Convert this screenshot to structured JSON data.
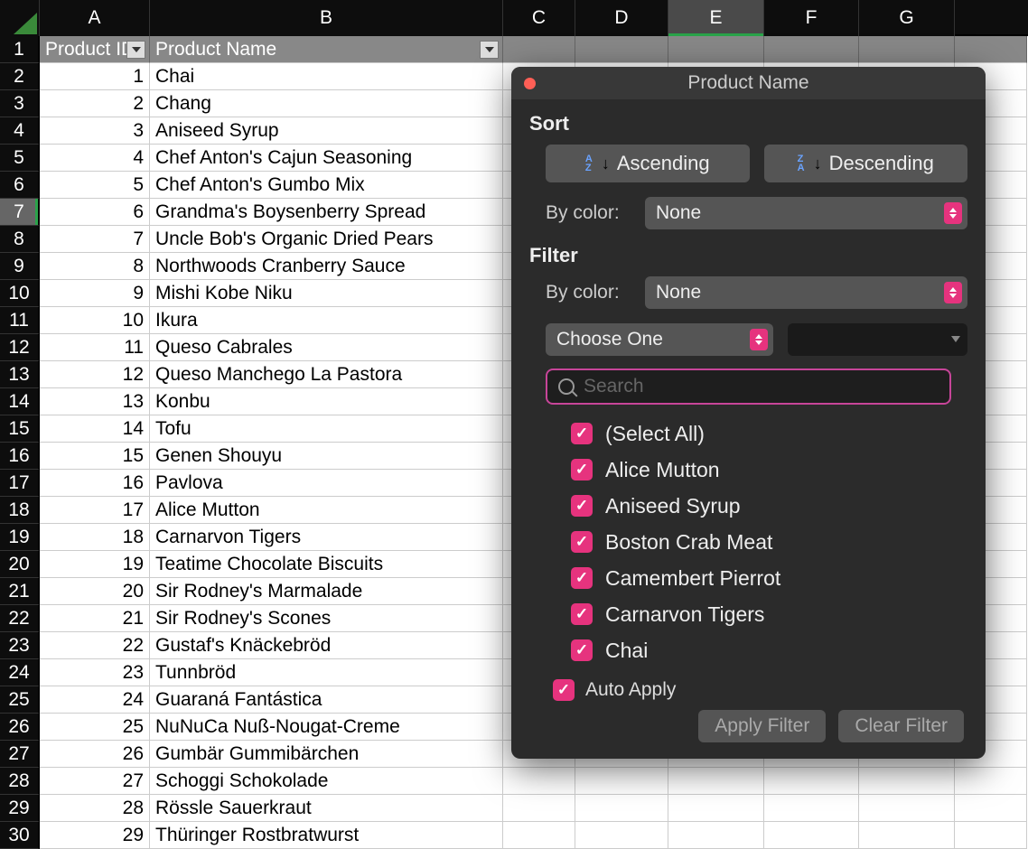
{
  "columns": [
    "A",
    "B",
    "C",
    "D",
    "E",
    "F",
    "G"
  ],
  "active_column": "E",
  "active_row": 7,
  "headers": {
    "a": "Product ID",
    "b": "Product Name"
  },
  "rows": [
    {
      "n": 1,
      "id": "",
      "name": ""
    },
    {
      "n": 2,
      "id": "1",
      "name": "Chai"
    },
    {
      "n": 3,
      "id": "2",
      "name": "Chang"
    },
    {
      "n": 4,
      "id": "3",
      "name": "Aniseed Syrup"
    },
    {
      "n": 5,
      "id": "4",
      "name": "Chef Anton's Cajun Seasoning"
    },
    {
      "n": 6,
      "id": "5",
      "name": "Chef Anton's Gumbo Mix"
    },
    {
      "n": 7,
      "id": "6",
      "name": "Grandma's Boysenberry Spread"
    },
    {
      "n": 8,
      "id": "7",
      "name": "Uncle Bob's Organic Dried Pears"
    },
    {
      "n": 9,
      "id": "8",
      "name": "Northwoods Cranberry Sauce"
    },
    {
      "n": 10,
      "id": "9",
      "name": "Mishi Kobe Niku"
    },
    {
      "n": 11,
      "id": "10",
      "name": "Ikura"
    },
    {
      "n": 12,
      "id": "11",
      "name": "Queso Cabrales"
    },
    {
      "n": 13,
      "id": "12",
      "name": "Queso Manchego La Pastora"
    },
    {
      "n": 14,
      "id": "13",
      "name": "Konbu"
    },
    {
      "n": 15,
      "id": "14",
      "name": "Tofu"
    },
    {
      "n": 16,
      "id": "15",
      "name": "Genen Shouyu"
    },
    {
      "n": 17,
      "id": "16",
      "name": "Pavlova"
    },
    {
      "n": 18,
      "id": "17",
      "name": "Alice Mutton"
    },
    {
      "n": 19,
      "id": "18",
      "name": "Carnarvon Tigers"
    },
    {
      "n": 20,
      "id": "19",
      "name": "Teatime Chocolate Biscuits"
    },
    {
      "n": 21,
      "id": "20",
      "name": "Sir Rodney's Marmalade"
    },
    {
      "n": 22,
      "id": "21",
      "name": "Sir Rodney's Scones"
    },
    {
      "n": 23,
      "id": "22",
      "name": "Gustaf's Knäckebröd"
    },
    {
      "n": 24,
      "id": "23",
      "name": "Tunnbröd"
    },
    {
      "n": 25,
      "id": "24",
      "name": "Guaraná Fantástica"
    },
    {
      "n": 26,
      "id": "25",
      "name": "NuNuCa Nuß-Nougat-Creme"
    },
    {
      "n": 27,
      "id": "26",
      "name": "Gumbär Gummibärchen"
    },
    {
      "n": 28,
      "id": "27",
      "name": "Schoggi Schokolade"
    },
    {
      "n": 29,
      "id": "28",
      "name": "Rössle Sauerkraut"
    },
    {
      "n": 30,
      "id": "29",
      "name": "Thüringer Rostbratwurst"
    }
  ],
  "popup": {
    "title": "Product Name",
    "sort_label": "Sort",
    "ascending": "Ascending",
    "descending": "Descending",
    "by_color": "By color:",
    "none": "None",
    "filter_label": "Filter",
    "choose_one": "Choose One",
    "search_placeholder": "Search",
    "items": [
      "(Select All)",
      "Alice Mutton",
      "Aniseed Syrup",
      "Boston Crab Meat",
      "Camembert Pierrot",
      "Carnarvon Tigers",
      "Chai"
    ],
    "auto_apply": "Auto Apply",
    "apply_filter": "Apply Filter",
    "clear_filter": "Clear Filter"
  }
}
